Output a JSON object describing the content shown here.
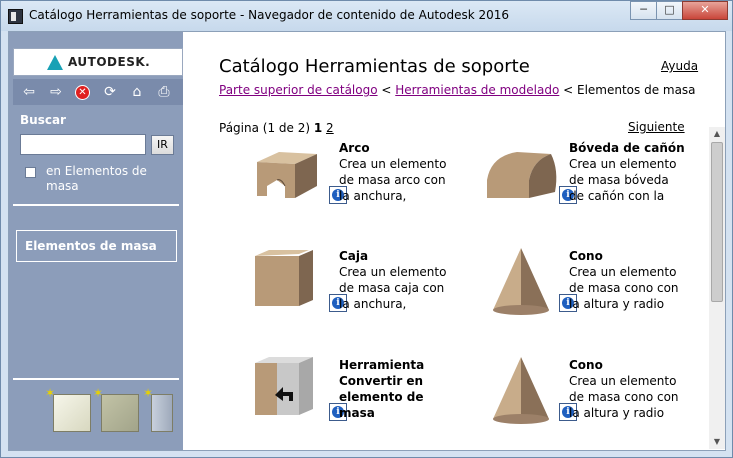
{
  "window": {
    "title": "Catálogo Herramientas de soporte - Navegador de contenido de Autodesk 2016",
    "minimize": "─",
    "maximize": "□",
    "close": "✕"
  },
  "sidebar": {
    "logo_text": "AUTODESK.",
    "nav": {
      "back": "⇦",
      "forward": "⇨",
      "stop": "✕",
      "refresh": "⟳",
      "home": "⌂",
      "print": "⎙"
    },
    "search_label": "Buscar",
    "search_value": "",
    "go_label": "IR",
    "scope_label": "en Elementos de masa",
    "current_palette": "Elementos de masa",
    "tool_icons": [
      "new-catalog-icon",
      "new-palette-icon",
      "new-tool-icon"
    ]
  },
  "main": {
    "title": "Catálogo Herramientas de soporte",
    "help": "Ayuda",
    "breadcrumb": {
      "root": "Parte superior de catálogo",
      "sep1": " < ",
      "parent": "Herramientas de modelado",
      "sep2": " < ",
      "current": "Elementos de masa"
    },
    "pager": {
      "prefix": "Página (1 de 2) ",
      "current": "1",
      "page2": "2",
      "next": "Siguiente"
    },
    "tools": [
      {
        "name": "Arco",
        "desc": "Crea un elemento de masa arco con la anchura,",
        "icon": "arch-icon"
      },
      {
        "name": "Bóveda de cañón",
        "desc": "Crea un elemento de masa bóveda de cañón con la",
        "icon": "barrel-vault-icon"
      },
      {
        "name": "Caja",
        "desc": "Crea un elemento de masa caja con la anchura,",
        "icon": "box-icon"
      },
      {
        "name": "Cono",
        "desc": "Crea un elemento de masa cono con la altura y radio",
        "icon": "cone-icon"
      },
      {
        "name": "Herramienta Convertir en elemento de masa",
        "desc": "",
        "icon": "convert-to-mass-icon"
      },
      {
        "name": "Cono",
        "desc": "Crea un elemento de masa cono con la altura y radio",
        "icon": "cone-icon"
      }
    ],
    "info_glyph": "i"
  },
  "colors": {
    "sidebar": "#8c9dba",
    "link_visited": "#800080",
    "info_blue": "#1f5fbf"
  }
}
